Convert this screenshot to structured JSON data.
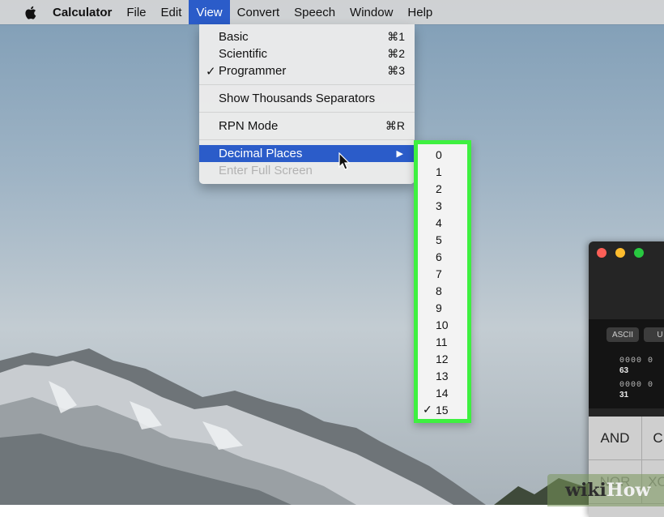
{
  "menubar": {
    "app_name": "Calculator",
    "items": [
      "File",
      "Edit",
      "View",
      "Convert",
      "Speech",
      "Window",
      "Help"
    ],
    "active": "View"
  },
  "view_menu": {
    "basic": {
      "label": "Basic",
      "shortcut": "⌘1"
    },
    "scientific": {
      "label": "Scientific",
      "shortcut": "⌘2"
    },
    "programmer": {
      "label": "Programmer",
      "shortcut": "⌘3",
      "checked": true
    },
    "thousands": {
      "label": "Show Thousands Separators"
    },
    "rpn": {
      "label": "RPN Mode",
      "shortcut": "⌘R"
    },
    "decimal": {
      "label": "Decimal Places",
      "highlighted": true
    },
    "fullscreen": {
      "label": "Enter Full Screen",
      "disabled": true
    }
  },
  "decimal_places_submenu": {
    "items": [
      "0",
      "1",
      "2",
      "3",
      "4",
      "5",
      "6",
      "7",
      "8",
      "9",
      "10",
      "11",
      "12",
      "13",
      "14",
      "15"
    ],
    "selected": "15",
    "highlight_color": "#3ef040"
  },
  "check_glyph": "✓",
  "calculator": {
    "modes": [
      "ASCII",
      "U"
    ],
    "bin_row1": "0000 0",
    "bit_label1": "63",
    "bin_row2": "0000 0",
    "bit_label2": "31",
    "keys": [
      "AND",
      "C",
      "NOR",
      "XO"
    ]
  },
  "watermark": {
    "part1": "wiki",
    "part2": "How"
  },
  "colors": {
    "accent": "#2b5cc9",
    "highlight": "#3ef040"
  }
}
